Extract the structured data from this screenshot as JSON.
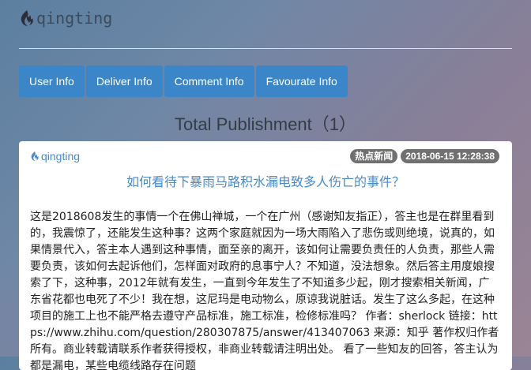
{
  "site": {
    "logo_text": "qingting"
  },
  "nav": {
    "items": [
      {
        "label": "User Info"
      },
      {
        "label": "Deliver Info"
      },
      {
        "label": "Comment Info"
      },
      {
        "label": "Favourate Info"
      }
    ]
  },
  "page": {
    "heading": "Total Publishment（1）"
  },
  "post": {
    "author": "qingting",
    "category": "热点新闻",
    "datetime": "2018-06-15 12:28:38",
    "title": "如何看待下暴雨马路积水漏电致多人伤亡的事件？",
    "body": "这是2018608发生的事情一个在佛山禅城，一个在广州（感谢知友指正），答主也是在群里看到的，我震惊了，还能发生这种事？这两个家庭就因为一场大雨陷入了悲伤或则绝境，说真的，如果情景代入，答主本人遇到这种事情，面至亲的离开，该如何让需要负责任的人负责，那些人需要负责，该如何去起诉他们，怎样面对政府的息事宁人？不知道，没法想象。然后答主用度娘搜索了下，这种事，2012年就有发生，一直到今年发生了不知道多少起，刚才搜索相关新闻，广东省花都也电死了不少！我在想，这尼玛是电动物么，原谅我说脏话。发生了这么多起，在这种项目的施工上也不能严格去遵守产品标准，施工标准，检修标准吗？ 作者：sherlock 链接：https://www.zhihu.com/question/280307875/answer/413407063 来源：知乎 著作权归作者所有。商业转载请联系作者获得授权，非商业转载请注明出处。 看了一些知友的回答，答主认为都是漏电，某些电缆线路存在问题"
  }
}
